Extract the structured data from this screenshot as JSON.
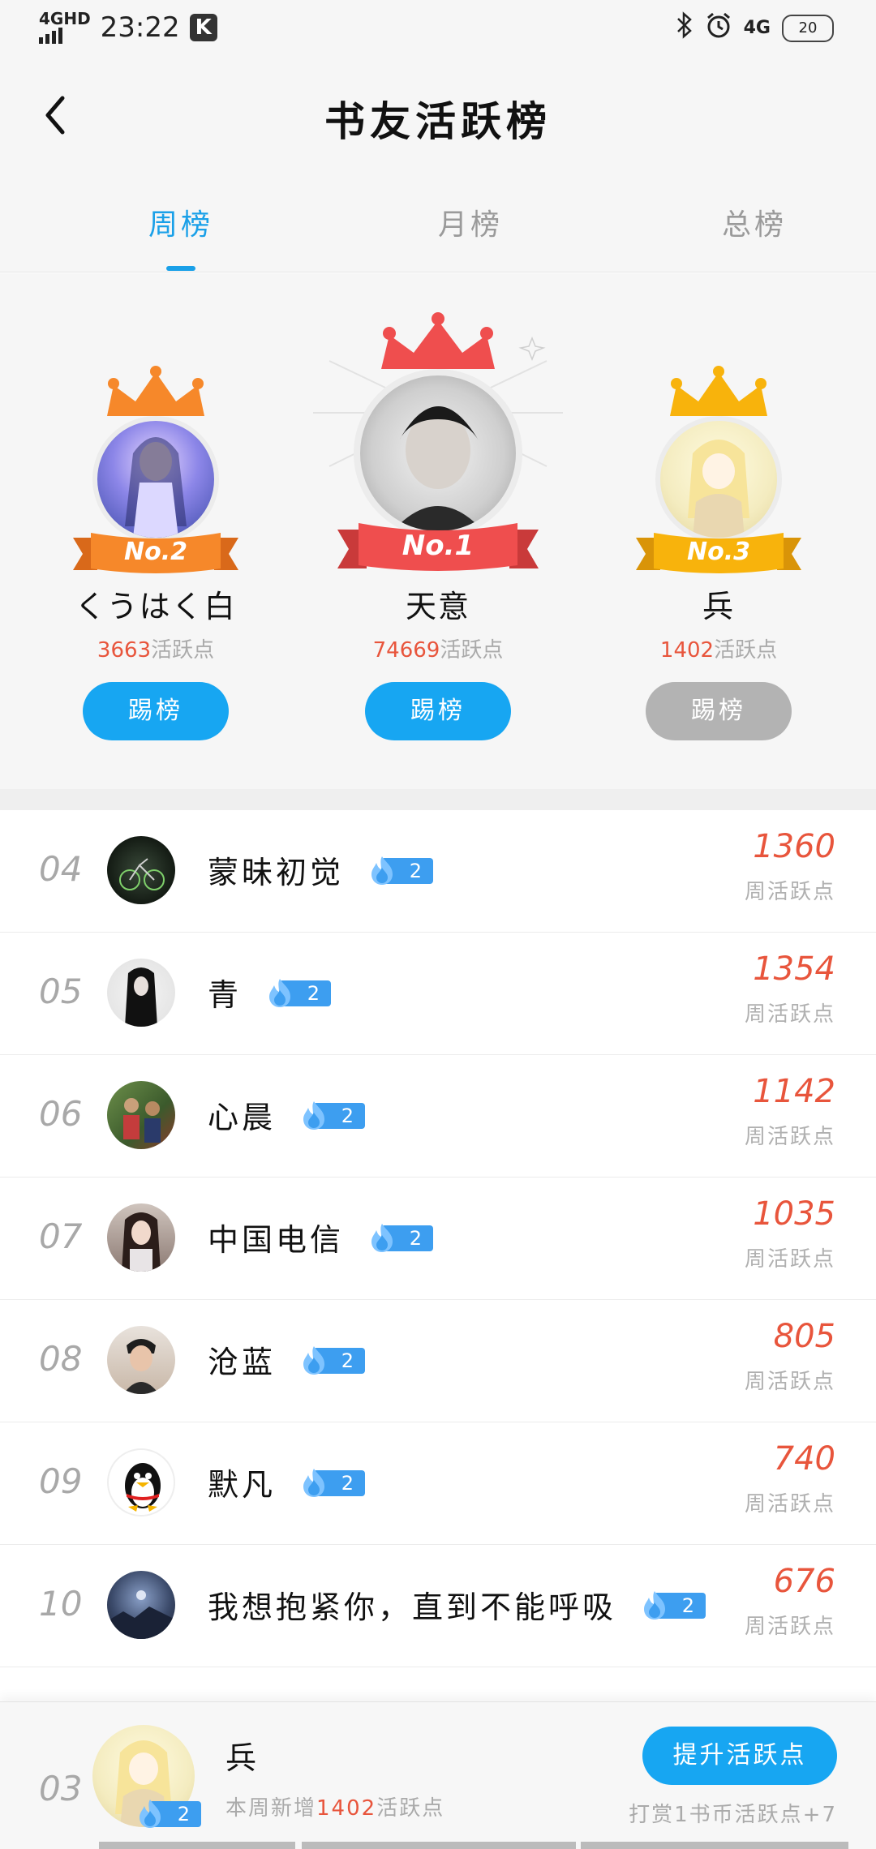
{
  "status_bar": {
    "network": "4GHD",
    "time": "23:22",
    "app_badge": "K",
    "right_network": "4G",
    "battery": "20"
  },
  "header": {
    "title": "书友活跃榜"
  },
  "tabs": [
    {
      "label": "周榜",
      "active": true
    },
    {
      "label": "月榜",
      "active": false
    },
    {
      "label": "总榜",
      "active": false
    }
  ],
  "podium": {
    "first": {
      "rank_label": "No.1",
      "name": "天意",
      "points": "74669",
      "points_suffix": "活跃点",
      "button": "踢榜",
      "color": "#ef4e4e",
      "avatar_icon": "person-photo"
    },
    "second": {
      "rank_label": "No.2",
      "name": "くうはく白",
      "points": "3663",
      "points_suffix": "活跃点",
      "button": "踢榜",
      "color": "#f6882a",
      "avatar_icon": "anime-girl"
    },
    "third": {
      "rank_label": "No.3",
      "name": "兵",
      "points": "1402",
      "points_suffix": "活跃点",
      "button": "踢榜",
      "color": "#f8b30c",
      "avatar_icon": "sketch-girl"
    }
  },
  "list": {
    "points_label": "周活跃点",
    "items": [
      {
        "rank": "04",
        "name": "蒙昧初觉",
        "level": "2",
        "points": "1360",
        "avatar_color": "#1f2a1f"
      },
      {
        "rank": "05",
        "name": "青",
        "level": "2",
        "points": "1354",
        "avatar_color": "#2c2c2c"
      },
      {
        "rank": "06",
        "name": "心晨",
        "level": "2",
        "points": "1142",
        "avatar_color": "#4a6b3a"
      },
      {
        "rank": "07",
        "name": "中国电信",
        "level": "2",
        "points": "1035",
        "avatar_color": "#7a6a6a"
      },
      {
        "rank": "08",
        "name": "沧蓝",
        "level": "2",
        "points": "805",
        "avatar_color": "#c9a890"
      },
      {
        "rank": "09",
        "name": "默凡",
        "level": "2",
        "points": "740",
        "avatar_color": "#ffffff"
      },
      {
        "rank": "10",
        "name": "我想抱紧你，直到不能呼吸",
        "level": "2",
        "points": "676",
        "avatar_color": "#3b4a6a"
      }
    ]
  },
  "me": {
    "rank": "03",
    "name": "兵",
    "level": "2",
    "sub_prefix": "本周新增",
    "sub_points": "1402",
    "sub_suffix": "活跃点",
    "button": "提升活跃点",
    "reward_note": "打赏1书币活跃点+7"
  },
  "colors": {
    "accent": "#17a6f2",
    "points": "#e8553c"
  }
}
